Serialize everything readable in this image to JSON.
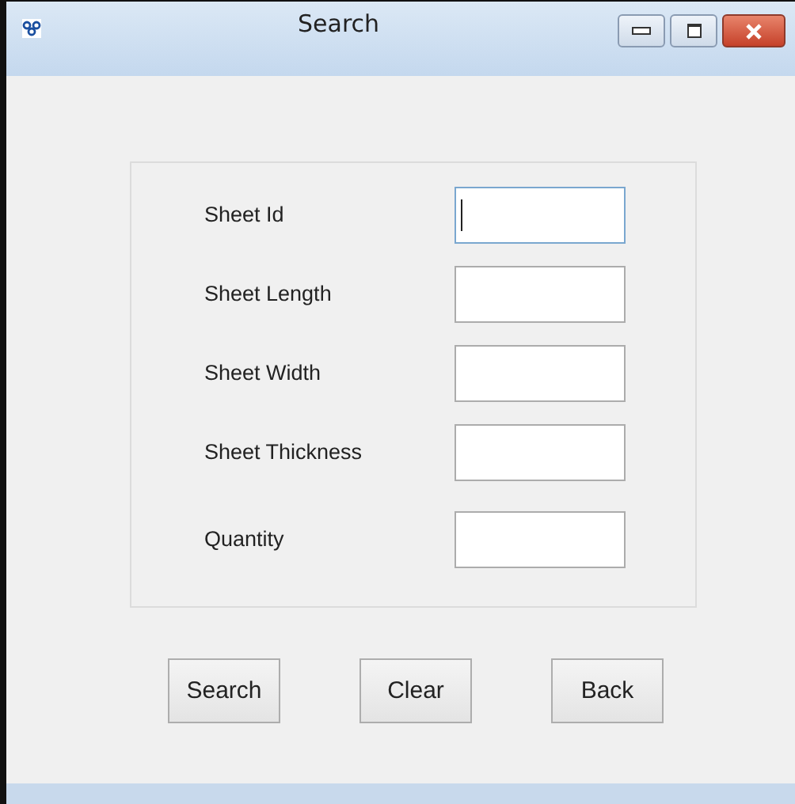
{
  "window": {
    "title": "Search"
  },
  "fields": [
    {
      "label": "Sheet Id",
      "focused": true
    },
    {
      "label": "Sheet Length",
      "focused": false
    },
    {
      "label": "Sheet Width",
      "focused": false
    },
    {
      "label": "Sheet Thickness",
      "focused": false
    },
    {
      "label": "Quantity",
      "focused": false
    }
  ],
  "buttons": [
    "Search",
    "Clear",
    "Back"
  ]
}
